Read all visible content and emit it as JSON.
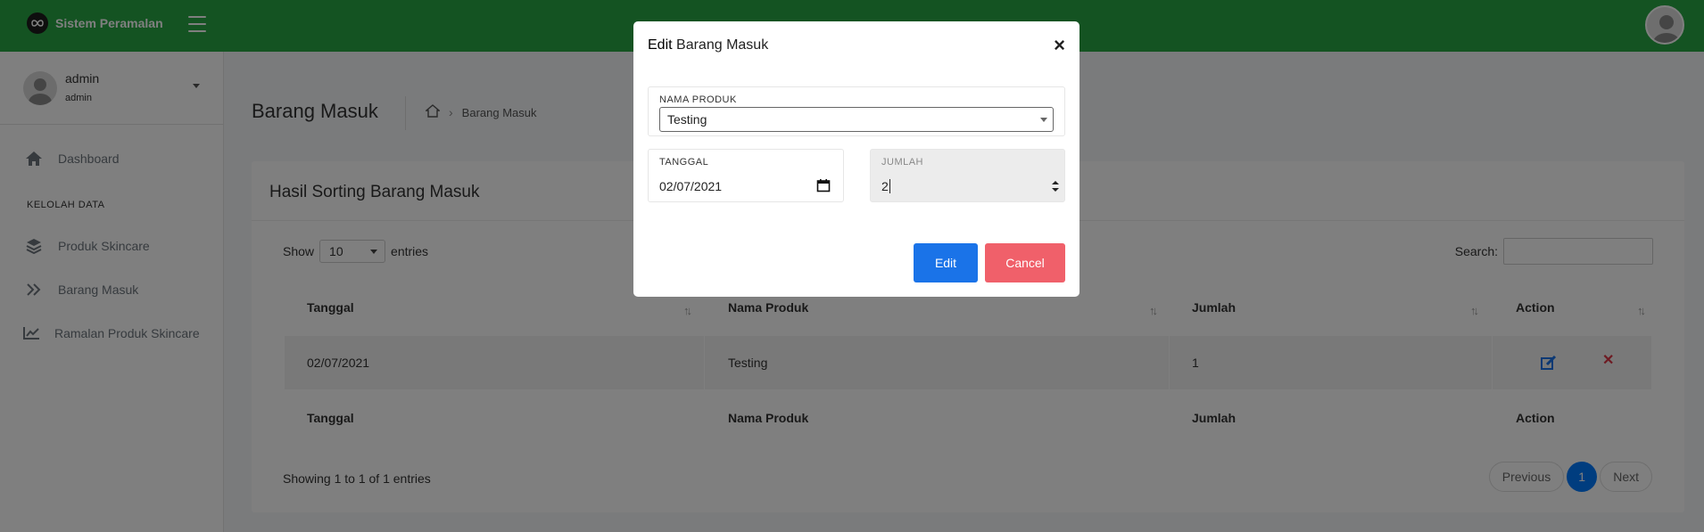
{
  "brand": {
    "name": "Sistem Peramalan"
  },
  "sidebar": {
    "user": {
      "name": "admin",
      "role": "admin"
    },
    "items": [
      {
        "label": "Dashboard",
        "icon": "home-icon"
      },
      {
        "label": "Produk Skincare",
        "icon": "layers-icon"
      },
      {
        "label": "Barang Masuk",
        "icon": "double-chevron-right-icon"
      },
      {
        "label": "Ramalan Produk Skincare",
        "icon": "line-chart-icon"
      }
    ],
    "section_header": "KELOLAH DATA"
  },
  "page": {
    "title": "Barang Masuk",
    "breadcrumb": {
      "home_icon": "home-icon",
      "current": "Barang Masuk"
    }
  },
  "card": {
    "title": "Hasil Sorting Barang Masuk",
    "show_prefix": "Show",
    "entries_value": "10",
    "show_suffix": "entries",
    "search_label": "Search:",
    "columns": [
      "Tanggal",
      "Nama Produk",
      "Jumlah",
      "Action"
    ],
    "rows": [
      {
        "tanggal": "02/07/2021",
        "nama_produk": "Testing",
        "jumlah": "1"
      }
    ],
    "info": "Showing 1 to 1 of 1 entries",
    "pager": {
      "previous": "Previous",
      "current": "1",
      "next": "Next"
    }
  },
  "modal": {
    "title_bold": "Edit",
    "title_rest": "Barang Masuk",
    "fields": {
      "produk_label": "NAMA PRODUK",
      "produk_value": "Testing",
      "tanggal_label": "TANGGAL",
      "tanggal_value": "02/07/2021",
      "jumlah_label": "JUMLAH",
      "jumlah_value": "2"
    },
    "edit_label": "Edit",
    "cancel_label": "Cancel"
  },
  "colors": {
    "topbar": "#28a745",
    "primary": "#1a73e8",
    "danger": "#f0606a",
    "delete_icon": "#dc3545"
  }
}
